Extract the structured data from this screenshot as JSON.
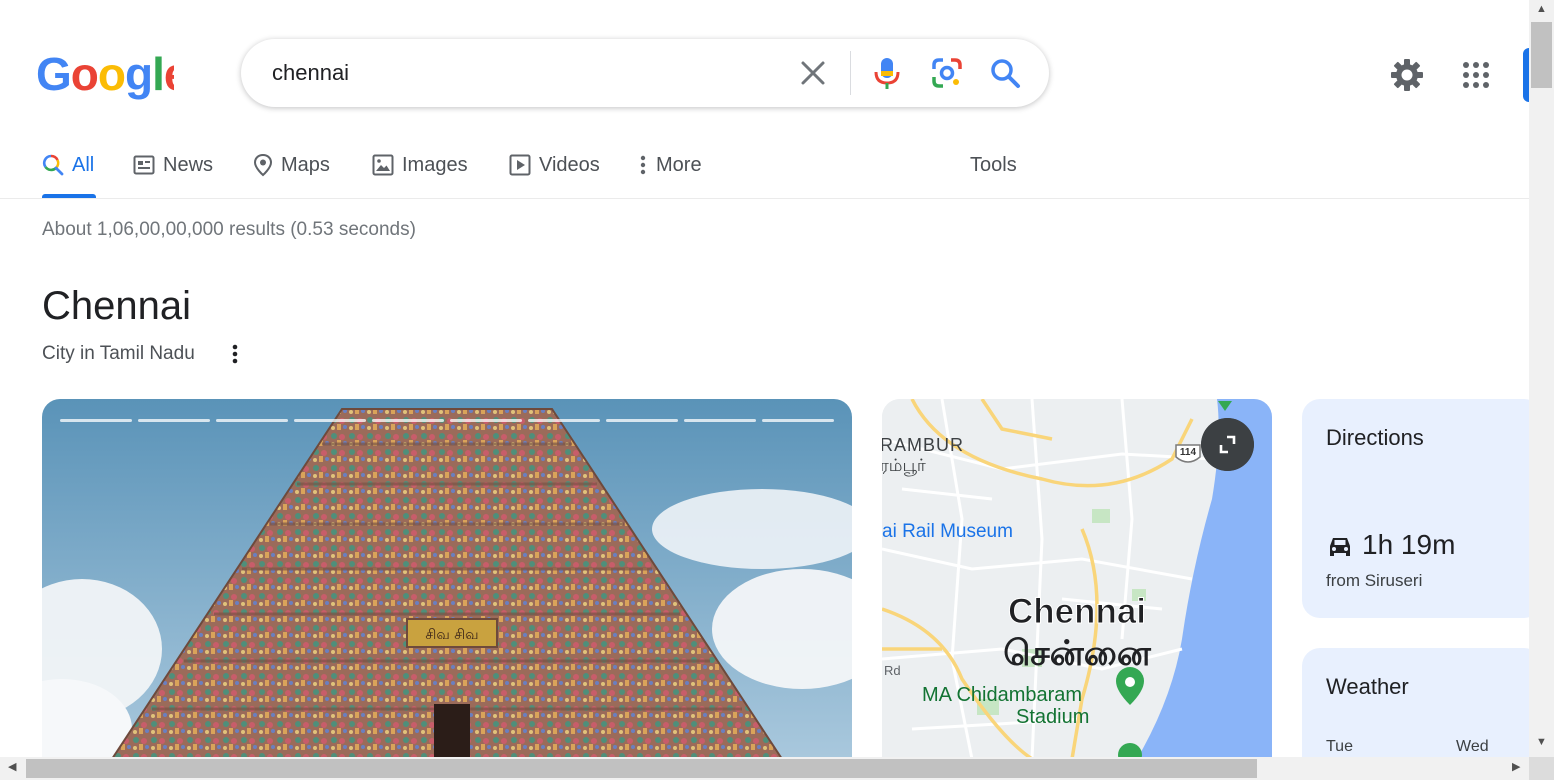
{
  "search": {
    "query": "chennai"
  },
  "tabs": [
    {
      "label": "All",
      "icon": "search-icon",
      "active": true
    },
    {
      "label": "News",
      "icon": "news-icon"
    },
    {
      "label": "Maps",
      "icon": "map-pin-icon"
    },
    {
      "label": "Images",
      "icon": "image-icon"
    },
    {
      "label": "Videos",
      "icon": "play-icon"
    },
    {
      "label": "More",
      "icon": "dots-vertical-icon"
    }
  ],
  "tools_label": "Tools",
  "result_stats": "About 1,06,00,00,000 results (0.53 seconds)",
  "knowledge_panel": {
    "title": "Chennai",
    "subtitle": "City in Tamil Nadu",
    "photo_sign_text": "சிவ சிவ",
    "map": {
      "labels": {
        "area_en": "RAMBUR",
        "area_ta": "ரம்பூர்",
        "museum": "ai Rail Museum",
        "city_en": "Chennai",
        "city_ta": "சென்னை",
        "stadium_line1": "MA Chidambaram",
        "stadium_line2": "Stadium",
        "road": "Rd",
        "highway": "114"
      }
    },
    "directions": {
      "title": "Directions",
      "time": "1h 19m",
      "from": "from Siruseri"
    },
    "weather": {
      "title": "Weather",
      "days": [
        "Tue",
        "Wed"
      ]
    }
  },
  "colors": {
    "accent": "#1a73e8",
    "card_bg": "#e8f0fe"
  }
}
